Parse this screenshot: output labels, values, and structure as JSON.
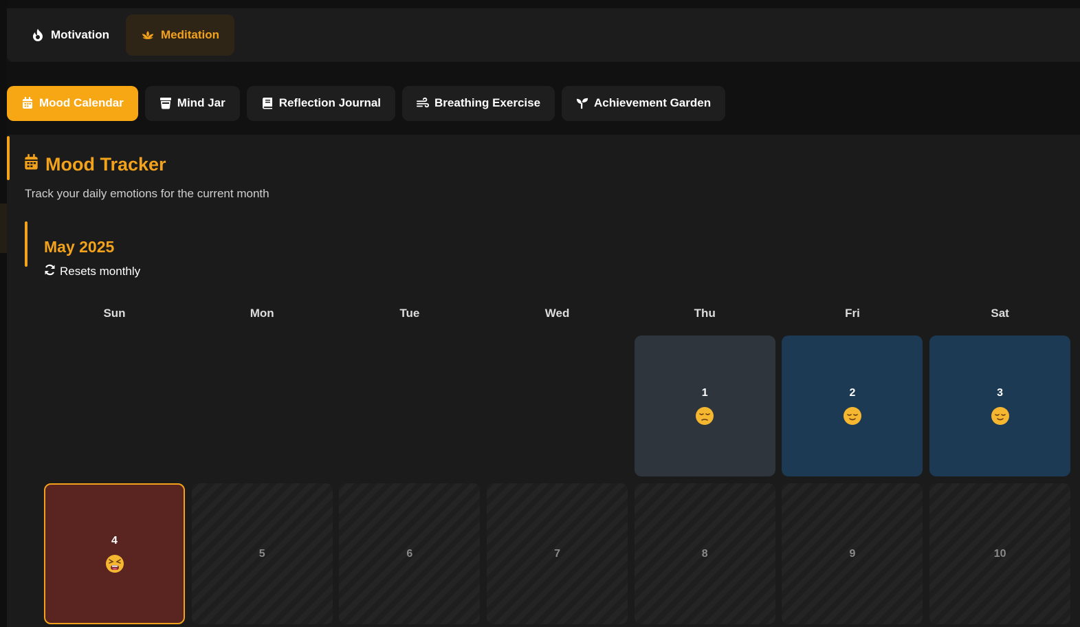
{
  "main_tabs": [
    {
      "label": "Motivation",
      "icon": "fire-icon",
      "active": false
    },
    {
      "label": "Meditation",
      "icon": "lotus-icon",
      "active": true
    }
  ],
  "sub_tabs": [
    {
      "label": "Mood Calendar",
      "icon": "calendar-icon",
      "active": true
    },
    {
      "label": "Mind Jar",
      "icon": "jar-icon",
      "active": false
    },
    {
      "label": "Reflection Journal",
      "icon": "book-icon",
      "active": false
    },
    {
      "label": "Breathing Exercise",
      "icon": "wind-icon",
      "active": false
    },
    {
      "label": "Achievement Garden",
      "icon": "seedling-icon",
      "active": false
    }
  ],
  "panel": {
    "title": "Mood Tracker",
    "subtitle": "Track your daily emotions for the current month"
  },
  "calendar": {
    "month": "May 2025",
    "reset_note": "Resets monthly",
    "weekdays": [
      "Sun",
      "Mon",
      "Tue",
      "Wed",
      "Thu",
      "Fri",
      "Sat"
    ],
    "days": [
      {
        "num": "1",
        "mood": "neutral",
        "emoji": "pensive-face"
      },
      {
        "num": "2",
        "mood": "calm",
        "emoji": "relieved-face"
      },
      {
        "num": "3",
        "mood": "calm",
        "emoji": "relieved-face"
      },
      {
        "num": "4",
        "mood": "upset",
        "emoji": "tired-face",
        "today": true
      },
      {
        "num": "5",
        "mood": "future"
      },
      {
        "num": "6",
        "mood": "future"
      },
      {
        "num": "7",
        "mood": "future"
      },
      {
        "num": "8",
        "mood": "future"
      },
      {
        "num": "9",
        "mood": "future"
      },
      {
        "num": "10",
        "mood": "future"
      }
    ]
  },
  "colors": {
    "accent": "#f3a21c",
    "neutral_day": "#2e353d",
    "calm_day": "#1d3a55",
    "upset_day": "#5a2421"
  }
}
